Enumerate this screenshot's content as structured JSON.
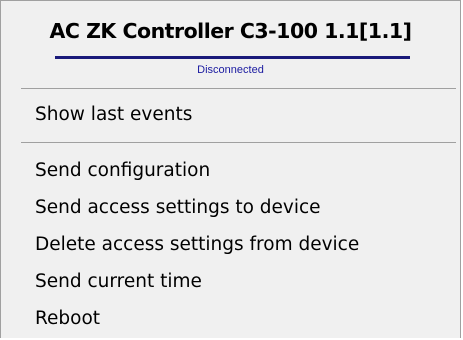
{
  "header": {
    "title": "AC ZK Controller C3-100 1.1[1.1]",
    "status": "Disconnected"
  },
  "menu": {
    "items": [
      {
        "label": "Show last events"
      },
      {
        "label": "Send configuration"
      },
      {
        "label": "Send access settings to device"
      },
      {
        "label": "Delete access settings from device"
      },
      {
        "label": "Send current time"
      },
      {
        "label": "Reboot"
      }
    ]
  },
  "colors": {
    "background": "#f0f0f0",
    "border": "#a0a0a0",
    "title_underline": "#1a1a7a",
    "status_text": "#1a1aa0",
    "text": "#000000"
  }
}
